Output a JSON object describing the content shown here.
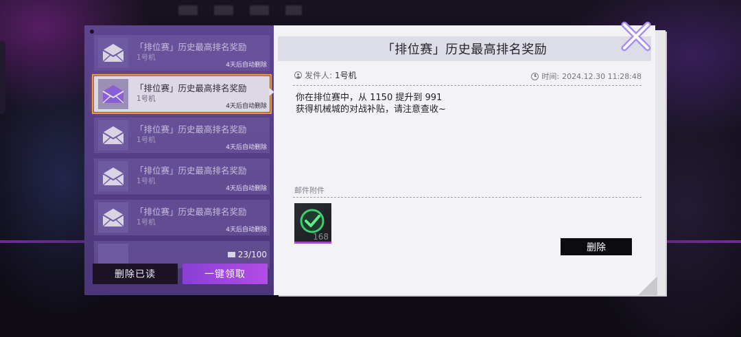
{
  "mail_list": {
    "items": [
      {
        "title": "「排位赛」历史最高排名奖励",
        "sender": "1号机",
        "expire": "4天后自动删除"
      },
      {
        "title": "「排位赛」历史最高排名奖励",
        "sender": "1号机",
        "expire": "4天后自动删除"
      },
      {
        "title": "「排位赛」历史最高排名奖励",
        "sender": "1号机",
        "expire": "4天后自动删除"
      },
      {
        "title": "「排位赛」历史最高排名奖励",
        "sender": "1号机",
        "expire": "4天后自动删除"
      },
      {
        "title": "「排位赛」历史最高排名奖励",
        "sender": "1号机",
        "expire": "4天后自动删除"
      }
    ],
    "selected_index": 1,
    "count": "23/100",
    "delete_read_label": "删除已读",
    "claim_all_label": "一键领取"
  },
  "detail": {
    "title": "「排位赛」历史最高排名奖励",
    "sender_label": "发件人:",
    "sender_value": "1号机",
    "time_label": "时间:",
    "time_value": "2024.12.30 11:28:48",
    "body_line1": "你在排位赛中，从 1150 提升到 991",
    "body_line2": "获得机械城的对战补贴，请注意查收~",
    "attachments_label": "邮件附件",
    "attachments": [
      {
        "icon": "green-check-icon",
        "quantity": "168"
      }
    ],
    "delete_label": "删除"
  },
  "colors": {
    "list_panel": "#5d4590",
    "selected_outline": "#f39a2c",
    "claim_button": "#a048d8",
    "paper": "#f3f3f5"
  }
}
